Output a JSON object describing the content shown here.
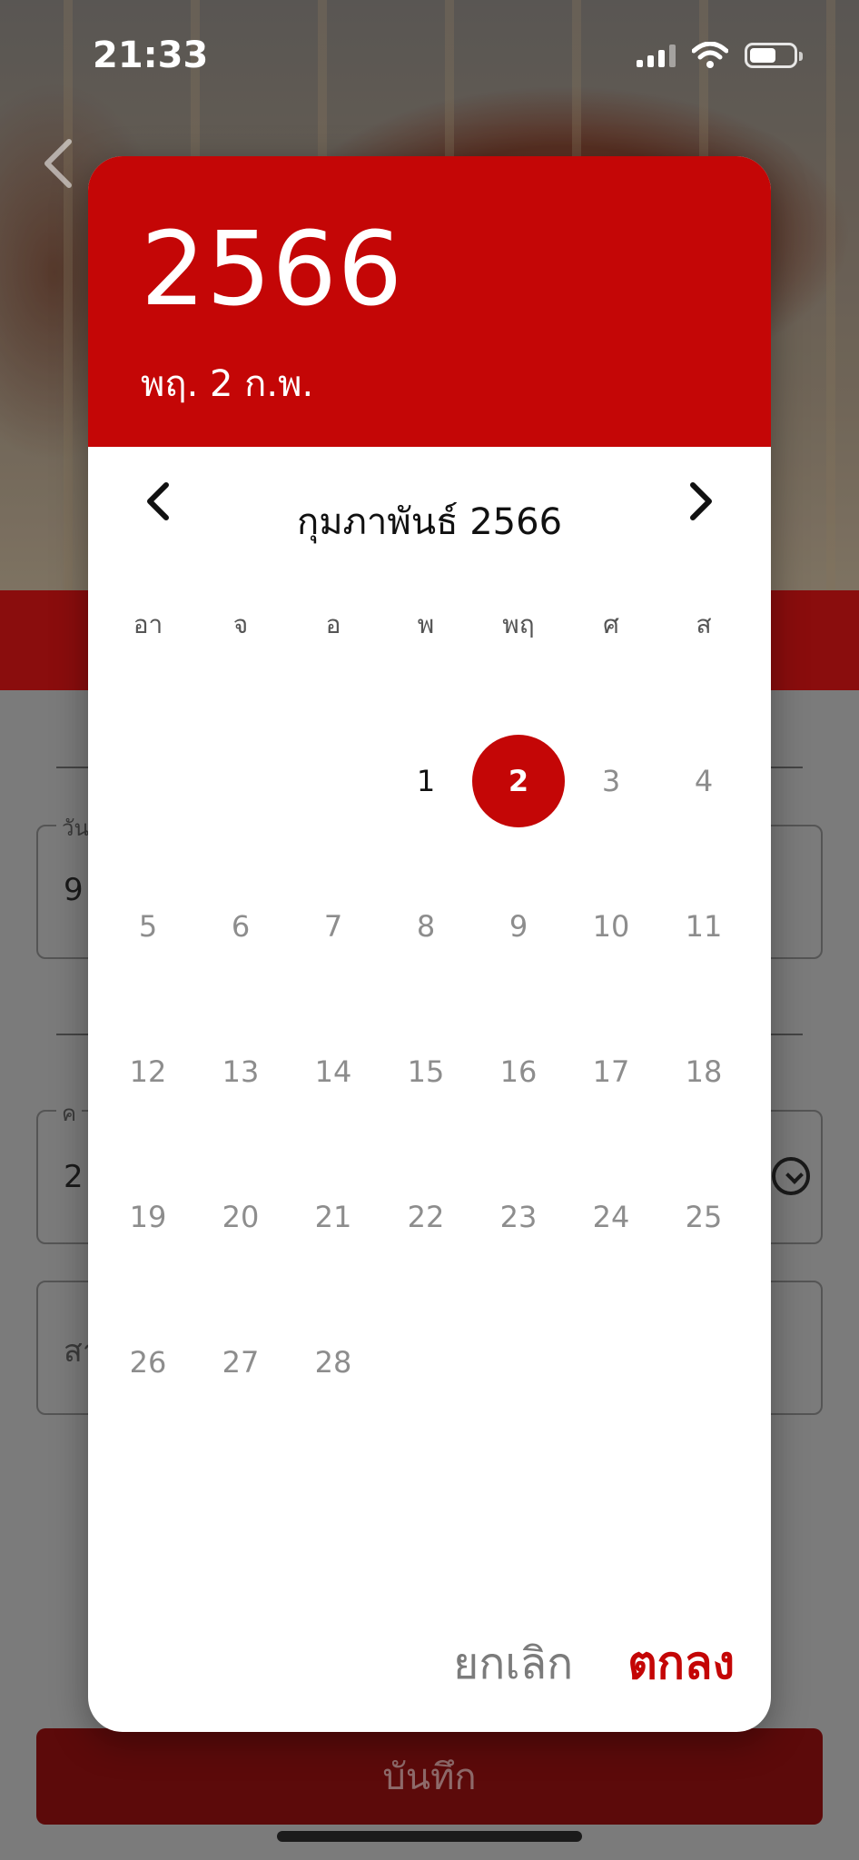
{
  "status_bar": {
    "time": "21:33",
    "signal_icon": "cellular-signal-icon",
    "wifi_icon": "wifi-icon",
    "battery_icon": "battery-icon"
  },
  "page": {
    "back_icon": "chevron-left-icon",
    "field_date": {
      "label": "วัน",
      "value": "9"
    },
    "field_time": {
      "label": "ค",
      "value": "2"
    },
    "field_note": {
      "placeholder": "สา"
    },
    "save_label": "บันทึก"
  },
  "date_picker": {
    "header": {
      "year": "2566",
      "selected_date": "พฤ. 2 ก.พ."
    },
    "month_title": "กุมภาพันธ์ 2566",
    "prev_icon": "chevron-left-icon",
    "next_icon": "chevron-right-icon",
    "weekdays": [
      "อา",
      "จ",
      "อ",
      "พ",
      "พฤ",
      "ศ",
      "ส"
    ],
    "leading_blank_days": 3,
    "days": [
      "1",
      "2",
      "3",
      "4",
      "5",
      "6",
      "7",
      "8",
      "9",
      "10",
      "11",
      "12",
      "13",
      "14",
      "15",
      "16",
      "17",
      "18",
      "19",
      "20",
      "21",
      "22",
      "23",
      "24",
      "25",
      "26",
      "27",
      "28"
    ],
    "selected_day": "2",
    "enabled_days": [
      "1",
      "2"
    ],
    "cancel_label": "ยกเลิก",
    "ok_label": "ตกลง"
  },
  "colors": {
    "accent": "#c40606",
    "disabled_day": "#8d8d8d",
    "cancel": "#7b7b7b"
  }
}
